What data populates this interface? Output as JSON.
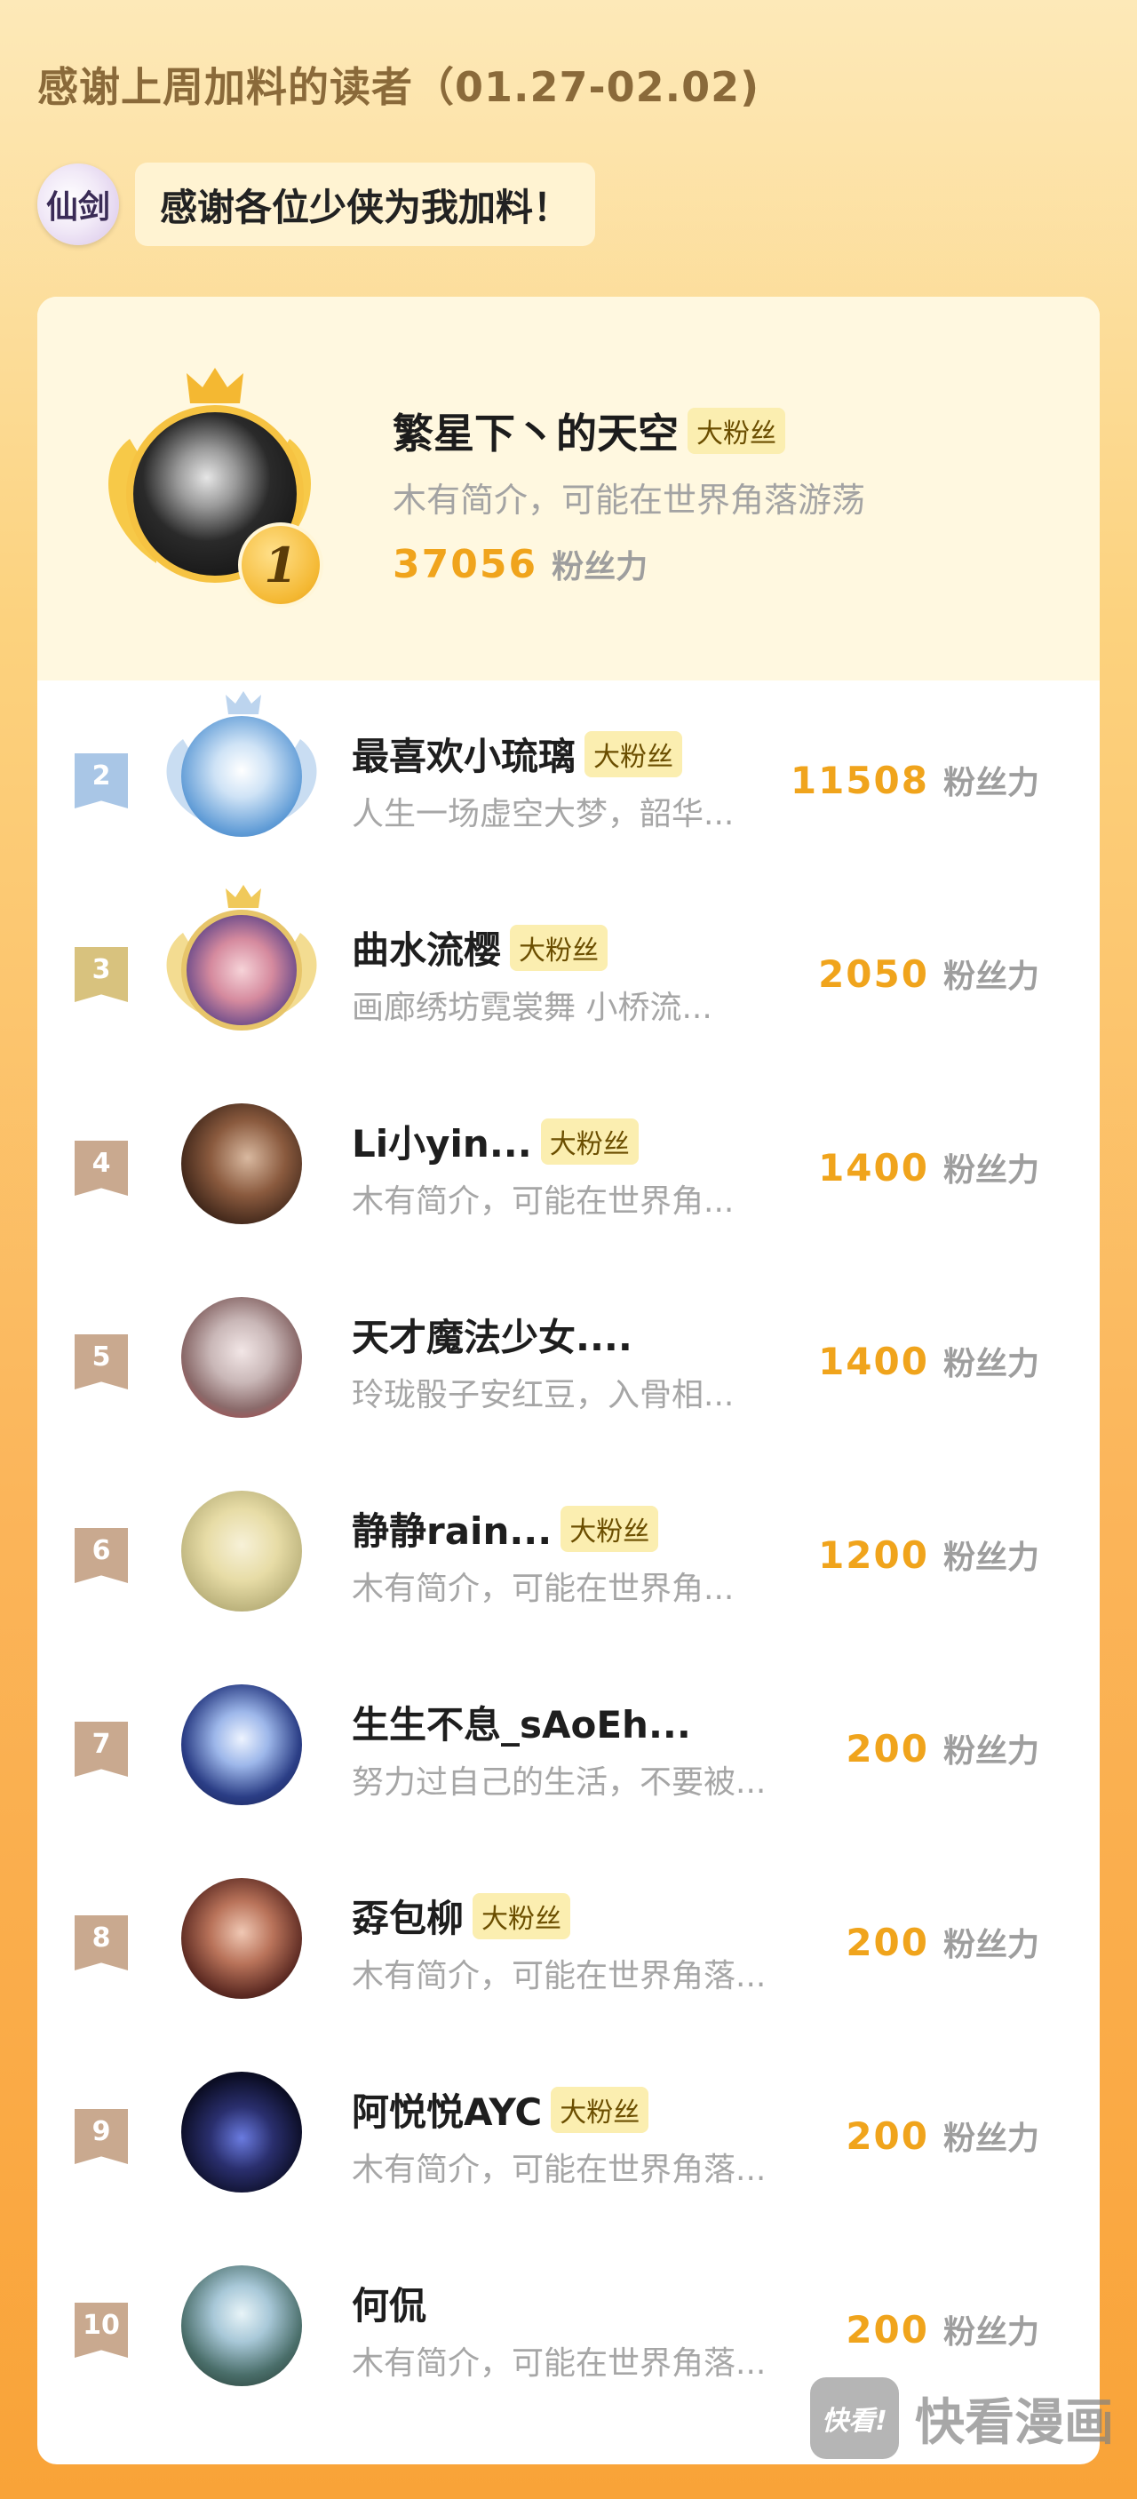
{
  "header": {
    "title": "感谢上周加料的读者（01.27-02.02)"
  },
  "thanks": {
    "logo_text": "仙剑",
    "message": "感谢各位少侠为我加料！"
  },
  "unit_label": "粉丝力",
  "top": {
    "rank": "1",
    "name": "繁星下丶的天空",
    "badge": "大粉丝",
    "bio": "木有简介，可能在世界角落游荡",
    "score": "37056"
  },
  "rows": [
    {
      "rank": "2",
      "name": "最喜欢小琉璃",
      "badge": "大粉丝",
      "bio": "人生一场虚空大梦，韶华...",
      "score": "11508",
      "tag_color": "#a9c6e6",
      "avatar_bg": "radial-gradient(circle at 50% 45%, #ffffff 0%, #cfe3f6 30%, #5f9bd6 70%, #3d76b8 100%)"
    },
    {
      "rank": "3",
      "name": "曲水流樱",
      "badge": "大粉丝",
      "bio": "画廊绣坊霓裳舞 小桥流...",
      "score": "2050",
      "tag_color": "#d8c27e",
      "avatar_bg": "radial-gradient(circle at 50% 50%, #f6d3d8 0%, #d58a9e 40%, #6a4a8a 75%, #3b3a5e 100%)"
    },
    {
      "rank": "4",
      "name": "Li小yin...",
      "badge": "大粉丝",
      "bio": "木有简介，可能在世界角...",
      "score": "1400",
      "tag_color": "#c9a98f",
      "avatar_bg": "radial-gradient(circle at 55% 45%, #d9b9a0 0%, #8a5a3e 40%, #3c2418 75%, #1a1010 100%)"
    },
    {
      "rank": "5",
      "name": "天才魔法少女....",
      "badge": "",
      "bio": "玲珑骰子安红豆，入骨相...",
      "score": "1400",
      "tag_color": "#c9a98f",
      "avatar_bg": "radial-gradient(circle at 50% 45%, #f2e6e6 0%, #c9b7b7 35%, #8a6a6a 65%, #c0333a 100%)"
    },
    {
      "rank": "6",
      "name": "静静rain...",
      "badge": "大粉丝",
      "bio": "木有简介，可能在世界角...",
      "score": "1200",
      "tag_color": "#c9a98f",
      "avatar_bg": "radial-gradient(circle at 50% 45%, #f7f1d8 0%, #e7dca6 40%, #b9b07a 75%, #8d8a5c 100%)"
    },
    {
      "rank": "7",
      "name": "生生不息_sAoEh...",
      "badge": "",
      "bio": "努力过自己的生活，不要被...",
      "score": "200",
      "tag_color": "#c9a98f",
      "avatar_bg": "radial-gradient(circle at 50% 45%, #eef4ff 0%, #9db7ea 30%, #2b3e86 65%, #0e1540 100%)"
    },
    {
      "rank": "8",
      "name": "孬包柳",
      "badge": "大粉丝",
      "bio": "木有简介，可能在世界角落...",
      "score": "200",
      "tag_color": "#c9a98f",
      "avatar_bg": "radial-gradient(circle at 50% 45%, #f0c8b4 0%, #b9735a 35%, #5c2a22 70%, #241010 100%)"
    },
    {
      "rank": "9",
      "name": "阿悦悦AYC",
      "badge": "大粉丝",
      "bio": "木有简介，可能在世界角落...",
      "score": "200",
      "tag_color": "#c9a98f",
      "avatar_bg": "radial-gradient(circle at 50% 55%, #6a7be0 0%, #2a2f6e 35%, #0b0d24 70%, #050610 100%)"
    },
    {
      "rank": "10",
      "name": "何侃",
      "badge": "",
      "bio": "木有简介，可能在世界角落...",
      "score": "200",
      "tag_color": "#c9a98f",
      "avatar_bg": "radial-gradient(circle at 50% 40%, #e8f4f8 0%, #a8c8d8 30%, #4a6e6a 65%, #1e3028 100%)"
    }
  ],
  "watermark": {
    "box_text": "快看!",
    "text": "快看漫画"
  }
}
